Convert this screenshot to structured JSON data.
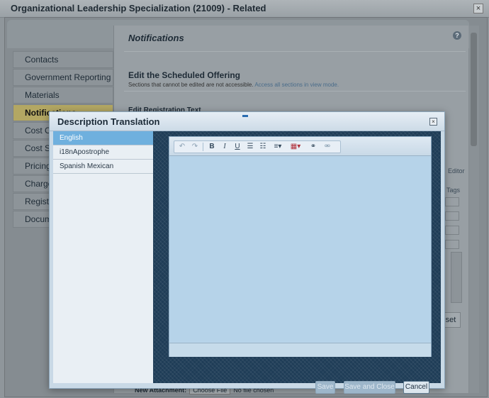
{
  "window": {
    "title": "Organizational Leadership Specialization (21009) - Related",
    "close_glyph": "×"
  },
  "background": {
    "section_heading": "Notifications",
    "help_glyph": "?",
    "edit_title": "Edit the Scheduled Offering",
    "edit_subtitle_a": "Sections that cannot be edited are not accessible. ",
    "edit_subtitle_link": "Access all sections in view mode.",
    "edit_reg_text": "Edit Registration Text",
    "nav_items": [
      {
        "label": "Contacts"
      },
      {
        "label": "Government Reporting"
      },
      {
        "label": "Materials"
      },
      {
        "label": "Notifications",
        "active": true
      },
      {
        "label": "Cost C"
      },
      {
        "label": "Cost S"
      },
      {
        "label": "Pricing"
      },
      {
        "label": "Charge"
      },
      {
        "label": "Registr"
      },
      {
        "label": "Docum"
      }
    ],
    "right_label_editor": "Editor",
    "right_label_tags": "Tags",
    "reset_button": "set",
    "new_attachment_label": "New Attachment:",
    "choose_file_button": "Choose File",
    "no_file_text": "No file chosen"
  },
  "modal": {
    "title": "Description Translation",
    "close_glyph": "×",
    "languages": [
      {
        "label": "English",
        "selected": true
      },
      {
        "label": "i18nApostrophe",
        "selected": false
      },
      {
        "label": "Spanish Mexican",
        "selected": false
      }
    ],
    "toolbar": {
      "undo": "↶",
      "redo": "↷",
      "bold": "B",
      "italic": "I",
      "underline": "U",
      "bullets": "☰",
      "numbers": "☷",
      "align": "≡▾",
      "table": "▦▾",
      "link": "⚭",
      "unlink": "⚮"
    },
    "buttons": {
      "save": "Save",
      "save_close": "Save and Close",
      "cancel": "Cancel"
    }
  }
}
